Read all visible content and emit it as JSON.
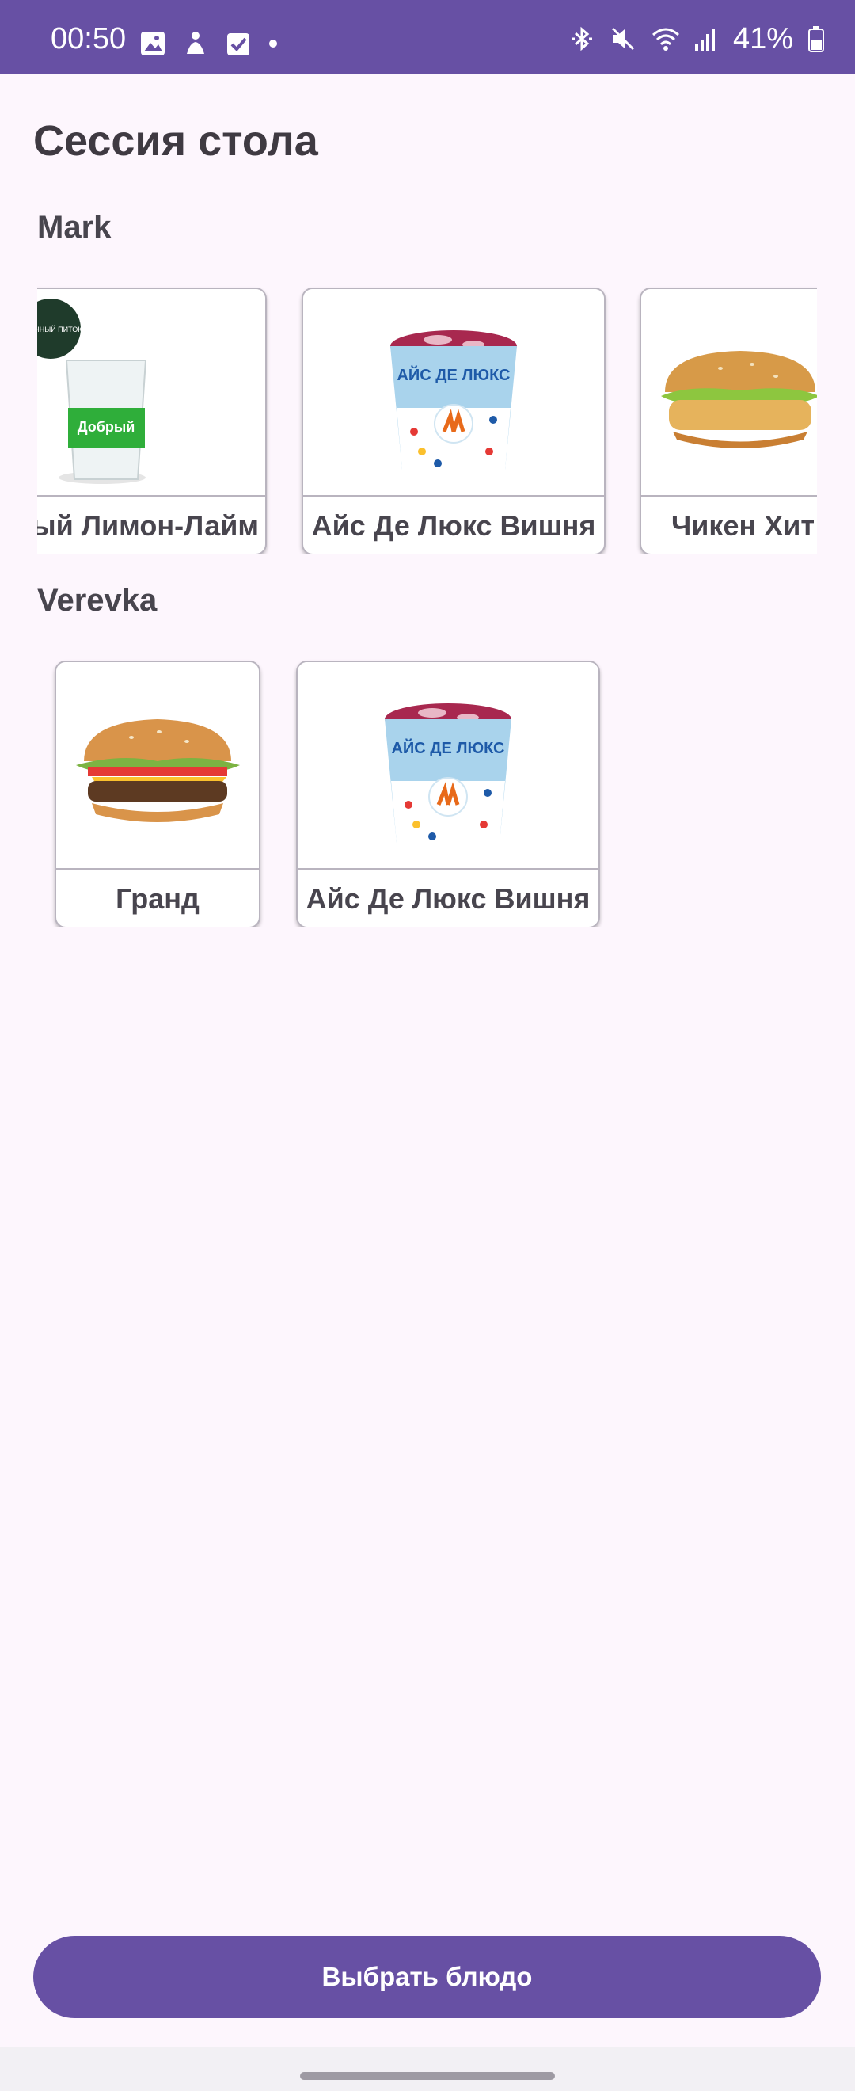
{
  "status_bar": {
    "time": "00:50",
    "battery_text": "41%",
    "left_icons": [
      "gallery-icon",
      "meditation-icon",
      "task-check-icon",
      "dot-icon"
    ],
    "right_icons": [
      "bluetooth-icon",
      "mute-icon",
      "wifi-icon",
      "signal-icon",
      "battery-icon"
    ]
  },
  "page": {
    "title": "Сессия стола"
  },
  "sections": [
    {
      "user": "Mark",
      "items": [
        {
          "name": "ый Лимон-Лайм",
          "image": "lemonade-glass-image"
        },
        {
          "name": "Айс Де Люкс Вишня",
          "image": "ice-cream-cup-image"
        },
        {
          "name": "Чикен Хит",
          "image": "chicken-burger-image"
        }
      ]
    },
    {
      "user": "Verevka",
      "items": [
        {
          "name": "Гранд",
          "image": "grand-burger-image"
        },
        {
          "name": "Айс Де Люкс Вишня",
          "image": "ice-cream-cup-image"
        }
      ]
    }
  ],
  "product_print": {
    "cup_text": "АЙС ДЕ ЛЮКС",
    "drink_brand": "Добрый",
    "drink_badge": "ОВАННЫЙ ПИТОК"
  },
  "actions": {
    "choose_dish": "Выбрать блюдо"
  },
  "colors": {
    "primary": "#6750A4",
    "background": "#FDF6FD",
    "text": "#48454E"
  }
}
